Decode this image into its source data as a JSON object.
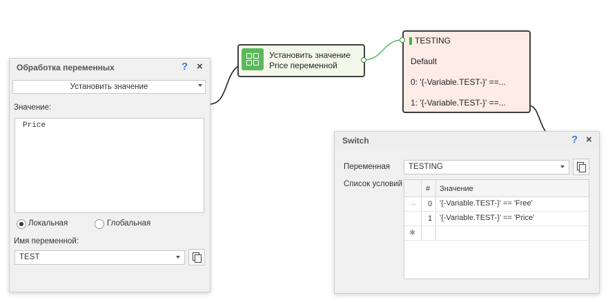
{
  "variable_panel": {
    "title": "Обработка переменных",
    "action_select": "Установить значение",
    "value_label": "Значение:",
    "value_text": "Price",
    "radio_local": "Локальная",
    "radio_global": "Глобальная",
    "radio_selected": "local",
    "var_name_label": "Имя переменной:",
    "var_name_value": "TEST",
    "icons": {
      "help": "?",
      "close": "×"
    }
  },
  "set_node": {
    "line1": "Установить значение",
    "line2": "Price переменной",
    "icon": "grid-icon",
    "color": "#5cb85c"
  },
  "switch_node": {
    "title": "TESTING",
    "default": "Default",
    "case0": "0: '{-Variable.TEST-}' ==...",
    "case1": "1: '{-Variable.TEST-}' ==...",
    "marker_color": "#3bb54a"
  },
  "switch_dialog": {
    "title": "Switch",
    "variable_label": "Переменная",
    "variable_value": "TESTING",
    "conditions_label": "Список условий",
    "columns": [
      "#",
      "Значение"
    ],
    "rows": [
      {
        "marker": "→",
        "index": "0",
        "value": "'{-Variable.TEST-}' == 'Free'"
      },
      {
        "marker": "",
        "index": "1",
        "value": "'{-Variable.TEST-}' == 'Price'"
      }
    ],
    "new_row_marker": "✱",
    "icons": {
      "help": "?",
      "close": "×"
    }
  }
}
